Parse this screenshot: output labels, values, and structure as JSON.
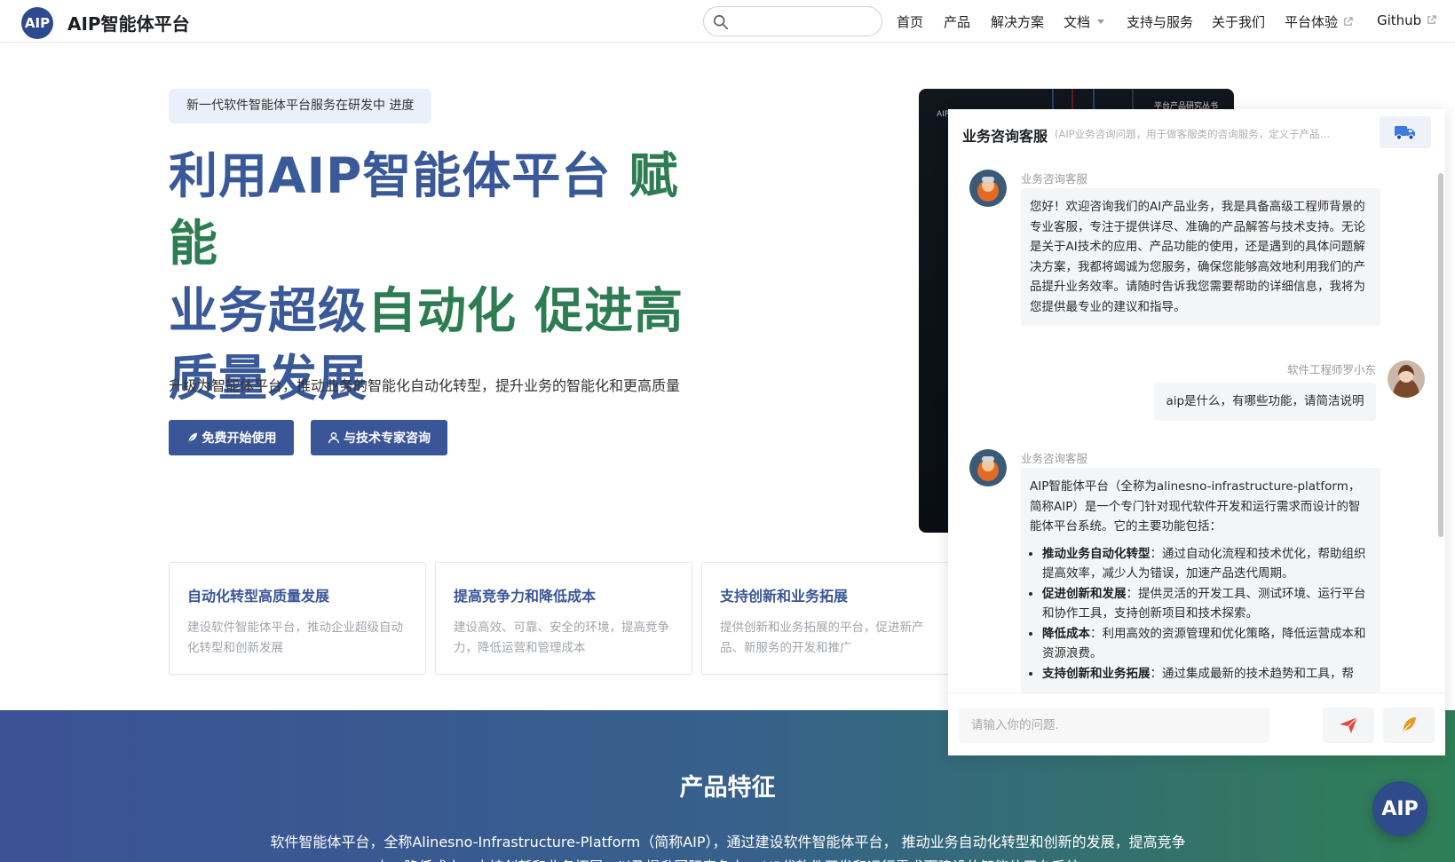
{
  "brand": {
    "logo_text": "AIP",
    "name": "AIP智能体平台"
  },
  "nav": {
    "items": [
      "首页",
      "产品",
      "解决方案",
      "文档",
      "支持与服务",
      "关于我们",
      "平台体验",
      "Github"
    ]
  },
  "search": {
    "placeholder": ""
  },
  "hero": {
    "badge": "新一代软件智能体平台服务在研发中 进度",
    "title_line1_blue": "利用AIP智能体平台",
    "title_line1_green": "赋能",
    "title_line2_blue": "业务超级",
    "title_line2_green": "自动化 促进高",
    "title_line3_blue": "质量发展",
    "subtitle": "升级为智能体平台，推动业务的智能化自动化转型，提升业务的智能化和更高质量",
    "btn_start": "免费开始使用",
    "btn_consult": "与技术专家咨询"
  },
  "dark_card": {
    "top_right": "平台产品研究丛书",
    "top_left": "AIP"
  },
  "features": [
    {
      "title": "自动化转型高质量发展",
      "desc": "建设软件智能体平台，推动企业超级自动化转型和创新发展"
    },
    {
      "title": "提高竞争力和降低成本",
      "desc": "建设高效、可靠、安全的环境，提高竞争力，降低运营和管理成本"
    },
    {
      "title": "支持创新和业务拓展",
      "desc": "提供创新和业务拓展的平台，促进新产品、新服务的开发和推广"
    }
  ],
  "band": {
    "title": "产品特征",
    "text": "软件智能体平台，全称Alinesno-Infrastructure-Platform（简称AIP），通过建设软件智能体平台， 推动业务自动化转型和创新的发展，提高竞争力，降低成本，支持创新和业务拓展，以及提升国际竞争力。AIP代软件开发和运行需求而建设的智能体平台系统"
  },
  "chat": {
    "title": "业务咨询客服",
    "desc": "(AIP业务咨询问题，用于做客服类的咨询服务，定义于产品业务对...)",
    "input_placeholder": "请输入你的问题.",
    "messages": [
      {
        "sender": "业务咨询客服",
        "text": "您好！欢迎咨询我们的AI产品业务，我是具备高级工程师背景的专业客服，专注于提供详尽、准确的产品解答与技术支持。无论是关于AI技术的应用、产品功能的使用，还是遇到的具体问题解决方案，我都将竭诚为您服务，确保您能够高效地利用我们的产品提升业务效率。请随时告诉我您需要帮助的详细信息，我将为您提供最专业的建议和指导。"
      },
      {
        "sender": "软件工程师罗小东",
        "text": "aip是什么，有哪些功能，请简洁说明"
      },
      {
        "sender": "业务咨询客服",
        "text": "AIP智能体平台（全称为alinesno-infrastructure-platform，简称AIP）是一个专门针对现代软件开发和运行需求而设计的智能体平台系统。它的主要功能包括：",
        "bullets": [
          {
            "bold": "推动业务自动化转型",
            "text": "：通过自动化流程和技术优化，帮助组织提高效率，减少人为错误，加速产品迭代周期。"
          },
          {
            "bold": "促进创新和发展",
            "text": "：提供灵活的开发工具、测试环境、运行平台和协作工具，支持创新项目和技术探索。"
          },
          {
            "bold": "降低成本",
            "text": "：利用高效的资源管理和优化策略，降低运营成本和资源浪费。"
          },
          {
            "bold": "支持创新和业务拓展",
            "text": "：通过集成最新的技术趋势和工具，帮"
          }
        ]
      }
    ]
  },
  "fab": {
    "text": "AIP"
  },
  "colors": {
    "primary": "#3a5598",
    "green": "#2e7d52",
    "band_start": "#3b5295",
    "band_end": "#2f7f55"
  }
}
